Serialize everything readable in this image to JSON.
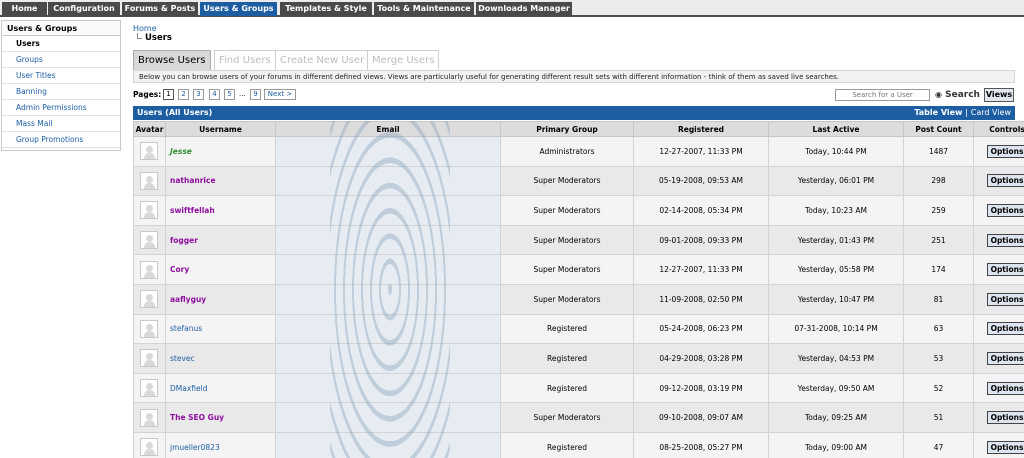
{
  "topnav": {
    "tabs": [
      {
        "label": "Home",
        "active": false
      },
      {
        "label": "Configuration",
        "active": false
      },
      {
        "label": "Forums & Posts",
        "active": false
      },
      {
        "label": "Users & Groups",
        "active": true
      },
      {
        "label": "Templates & Style",
        "active": false
      },
      {
        "label": "Tools & Maintenance",
        "active": false
      },
      {
        "label": "Downloads Manager",
        "active": false
      }
    ]
  },
  "sidebar": {
    "title": "Users & Groups",
    "items": [
      {
        "label": "Users",
        "active": true
      },
      {
        "label": "Groups"
      },
      {
        "label": "User Titles"
      },
      {
        "label": "Banning"
      },
      {
        "label": "Admin Permissions"
      },
      {
        "label": "Mass Mail"
      },
      {
        "label": "Group Promotions"
      }
    ]
  },
  "breadcrumb": {
    "home": "Home",
    "current": "Users"
  },
  "subtabs": [
    {
      "label": "Browse Users",
      "active": true
    },
    {
      "label": "Find Users"
    },
    {
      "label": "Create New User"
    },
    {
      "label": "Merge Users"
    }
  ],
  "description": "Below you can browse users of your forums in different defined views. Views are particularly useful for generating different result sets with different information - think of them as saved live searches.",
  "pagination": {
    "label": "Pages:",
    "pages": [
      "1",
      "2",
      "3",
      "4",
      "5"
    ],
    "ellipsis": "...",
    "last": "9",
    "next": "Next >",
    "current": "1"
  },
  "search": {
    "placeholder": "Search for a User",
    "button": "Search",
    "views_button": "Views"
  },
  "table": {
    "title": "Users (All Users)",
    "table_view": "Table View",
    "separator": "|",
    "card_view": "Card View",
    "columns": [
      "Avatar",
      "Username",
      "Email",
      "Primary Group",
      "Registered",
      "Last Active",
      "Post Count",
      "Controls"
    ],
    "options_label": "Options",
    "rows": [
      {
        "username": "Jesse",
        "role": "admin",
        "group": "Administrators",
        "registered": "12-27-2007, 11:33 PM",
        "last_active": "Today, 10:44 PM",
        "posts": "1487"
      },
      {
        "username": "nathanrice",
        "role": "mod",
        "group": "Super Moderators",
        "registered": "05-19-2008, 09:53 AM",
        "last_active": "Yesterday, 06:01 PM",
        "posts": "298"
      },
      {
        "username": "swiftfellah",
        "role": "mod",
        "group": "Super Moderators",
        "registered": "02-14-2008, 05:34 PM",
        "last_active": "Today, 10:23 AM",
        "posts": "259"
      },
      {
        "username": "fogger",
        "role": "mod",
        "group": "Super Moderators",
        "registered": "09-01-2008, 09:33 PM",
        "last_active": "Yesterday, 01:43 PM",
        "posts": "251"
      },
      {
        "username": "Cory",
        "role": "mod",
        "group": "Super Moderators",
        "registered": "12-27-2007, 11:33 PM",
        "last_active": "Yesterday, 05:58 PM",
        "posts": "174"
      },
      {
        "username": "aaflyguy",
        "role": "mod",
        "group": "Super Moderators",
        "registered": "11-09-2008, 02:50 PM",
        "last_active": "Yesterday, 10:47 PM",
        "posts": "81"
      },
      {
        "username": "stefanus",
        "role": "reg",
        "group": "Registered",
        "registered": "05-24-2008, 06:23 PM",
        "last_active": "07-31-2008, 10:14 PM",
        "posts": "63"
      },
      {
        "username": "stevec",
        "role": "reg",
        "group": "Registered",
        "registered": "04-29-2008, 03:28 PM",
        "last_active": "Yesterday, 04:53 PM",
        "posts": "53"
      },
      {
        "username": "DMaxfield",
        "role": "reg",
        "group": "Registered",
        "registered": "09-12-2008, 03:19 PM",
        "last_active": "Yesterday, 09:50 AM",
        "posts": "52"
      },
      {
        "username": "The SEO Guy",
        "role": "mod",
        "group": "Super Moderators",
        "registered": "09-10-2008, 09:07 AM",
        "last_active": "Today, 09:25 AM",
        "posts": "51"
      },
      {
        "username": "jmueller0823",
        "role": "reg",
        "group": "Registered",
        "registered": "08-25-2008, 05:27 PM",
        "last_active": "Today, 09:00 AM",
        "posts": "47"
      }
    ]
  },
  "colors": {
    "nav_bg": "#4a4a4a",
    "accent": "#1d5ea3",
    "admin": "#2d8a2d",
    "moderator": "#8e0e9e",
    "registered": "#1d5ea3"
  }
}
